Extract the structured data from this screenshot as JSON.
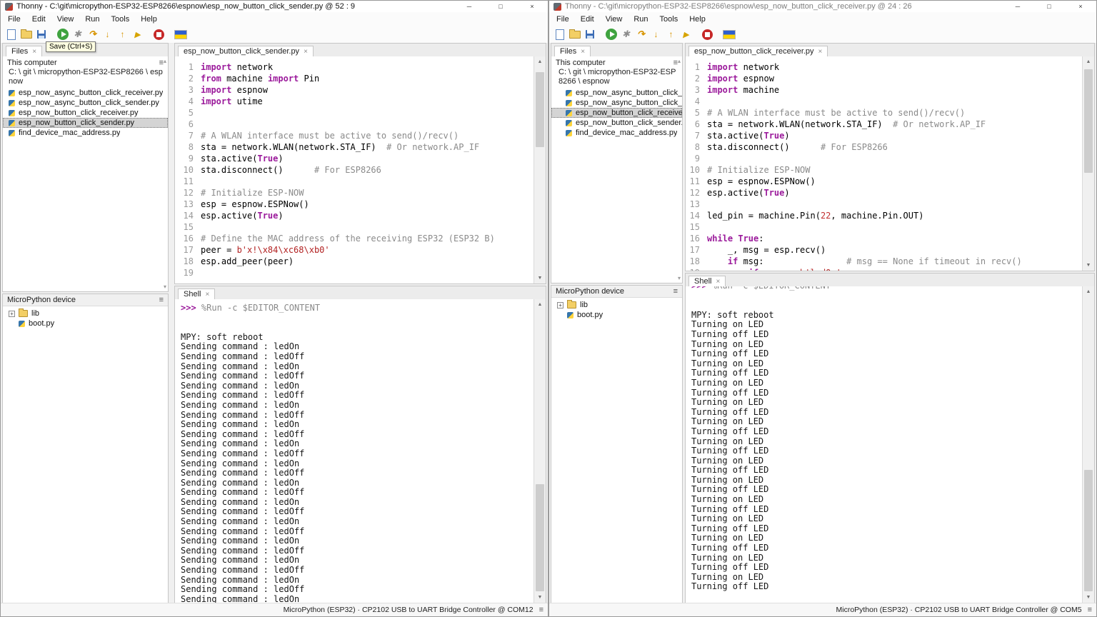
{
  "glyphs": {
    "minimize": "─",
    "maximize": "□",
    "close": "×",
    "pane_menu": "≡",
    "tab_close": "×",
    "expander": "+",
    "scroll_up": "▲",
    "scroll_down": "▼",
    "tree_scroll_up": "▴",
    "tree_scroll_down": "▾",
    "backend_menu": "≡"
  },
  "windows": [
    {
      "titlebar": {
        "title": "Thonny  -  C:\\git\\micropython-ESP32-ESP8266\\espnow\\esp_now_button_click_sender.py  @  52 : 9"
      },
      "menu": [
        "File",
        "Edit",
        "View",
        "Run",
        "Tools",
        "Help"
      ],
      "toolbar": [
        "new-file",
        "open-file",
        "save",
        "sep",
        "run",
        "debug",
        "step-over",
        "step-into",
        "step-out",
        "resume",
        "sep",
        "stop",
        "sep",
        "flag"
      ],
      "tooltip": {
        "text": "Save (Ctrl+S)"
      },
      "files_panel": {
        "tab": "Files",
        "root_label": "This computer",
        "path": "C: \\ git \\ micropython-ESP32-ESP8266 \\ espnow",
        "files": [
          {
            "name": "esp_now_async_button_click_receiver.py",
            "selected": false
          },
          {
            "name": "esp_now_async_button_click_sender.py",
            "selected": false
          },
          {
            "name": "esp_now_button_click_receiver.py",
            "selected": false
          },
          {
            "name": "esp_now_button_click_sender.py",
            "selected": true
          },
          {
            "name": "find_device_mac_address.py",
            "selected": false
          }
        ]
      },
      "device_panel": {
        "title": "MicroPython device",
        "items": [
          {
            "name": "lib",
            "type": "folder",
            "expander": true
          },
          {
            "name": "boot.py",
            "type": "file",
            "expander": false
          }
        ]
      },
      "editor": {
        "tab": "esp_now_button_click_sender.py",
        "lines": [
          {
            "n": 1,
            "segs": [
              [
                "kw",
                "import"
              ],
              [
                "pl",
                " network"
              ]
            ]
          },
          {
            "n": 2,
            "segs": [
              [
                "kw",
                "from"
              ],
              [
                "pl",
                " machine "
              ],
              [
                "kw",
                "import"
              ],
              [
                "pl",
                " Pin"
              ]
            ]
          },
          {
            "n": 3,
            "segs": [
              [
                "kw",
                "import"
              ],
              [
                "pl",
                " espnow"
              ]
            ]
          },
          {
            "n": 4,
            "segs": [
              [
                "kw",
                "import"
              ],
              [
                "pl",
                " utime"
              ]
            ]
          },
          {
            "n": 5,
            "segs": []
          },
          {
            "n": 6,
            "segs": []
          },
          {
            "n": 7,
            "segs": [
              [
                "com",
                "# A WLAN interface must be active to send()/recv()"
              ]
            ]
          },
          {
            "n": 8,
            "segs": [
              [
                "pl",
                "sta = network.WLAN(network.STA_IF)  "
              ],
              [
                "com",
                "# Or network.AP_IF"
              ]
            ]
          },
          {
            "n": 9,
            "segs": [
              [
                "pl",
                "sta.active("
              ],
              [
                "kw",
                "True"
              ],
              [
                "pl",
                ")"
              ]
            ]
          },
          {
            "n": 10,
            "segs": [
              [
                "pl",
                "sta.disconnect()      "
              ],
              [
                "com",
                "# For ESP8266"
              ]
            ]
          },
          {
            "n": 11,
            "segs": []
          },
          {
            "n": 12,
            "segs": [
              [
                "com",
                "# Initialize ESP-NOW"
              ]
            ]
          },
          {
            "n": 13,
            "segs": [
              [
                "pl",
                "esp = espnow.ESPNow()"
              ]
            ]
          },
          {
            "n": 14,
            "segs": [
              [
                "pl",
                "esp.active("
              ],
              [
                "kw",
                "True"
              ],
              [
                "pl",
                ")"
              ]
            ]
          },
          {
            "n": 15,
            "segs": []
          },
          {
            "n": 16,
            "segs": [
              [
                "com",
                "# Define the MAC address of the receiving ESP32 (ESP32 B)"
              ]
            ]
          },
          {
            "n": 17,
            "segs": [
              [
                "pl",
                "peer = "
              ],
              [
                "str",
                "b'x!\\x84\\xc68\\xb0'"
              ]
            ]
          },
          {
            "n": 18,
            "segs": [
              [
                "pl",
                "esp.add_peer(peer)"
              ]
            ]
          },
          {
            "n": 19,
            "segs": []
          }
        ]
      },
      "shell": {
        "tab": "Shell",
        "lines": [
          [
            [
              "prompt",
              ">>> "
            ],
            [
              "magic",
              "%Run -c $EDITOR_CONTENT"
            ]
          ],
          [],
          [],
          [
            [
              "out",
              "MPY: soft reboot"
            ]
          ],
          [
            [
              "out",
              "Sending command : ledOn"
            ]
          ],
          [
            [
              "out",
              "Sending command : ledOff"
            ]
          ],
          [
            [
              "out",
              "Sending command : ledOn"
            ]
          ],
          [
            [
              "out",
              "Sending command : ledOff"
            ]
          ],
          [
            [
              "out",
              "Sending command : ledOn"
            ]
          ],
          [
            [
              "out",
              "Sending command : ledOff"
            ]
          ],
          [
            [
              "out",
              "Sending command : ledOn"
            ]
          ],
          [
            [
              "out",
              "Sending command : ledOff"
            ]
          ],
          [
            [
              "out",
              "Sending command : ledOn"
            ]
          ],
          [
            [
              "out",
              "Sending command : ledOff"
            ]
          ],
          [
            [
              "out",
              "Sending command : ledOn"
            ]
          ],
          [
            [
              "out",
              "Sending command : ledOff"
            ]
          ],
          [
            [
              "out",
              "Sending command : ledOn"
            ]
          ],
          [
            [
              "out",
              "Sending command : ledOff"
            ]
          ],
          [
            [
              "out",
              "Sending command : ledOn"
            ]
          ],
          [
            [
              "out",
              "Sending command : ledOff"
            ]
          ],
          [
            [
              "out",
              "Sending command : ledOn"
            ]
          ],
          [
            [
              "out",
              "Sending command : ledOff"
            ]
          ],
          [
            [
              "out",
              "Sending command : ledOn"
            ]
          ],
          [
            [
              "out",
              "Sending command : ledOff"
            ]
          ],
          [
            [
              "out",
              "Sending command : ledOn"
            ]
          ],
          [
            [
              "out",
              "Sending command : ledOff"
            ]
          ],
          [
            [
              "out",
              "Sending command : ledOn"
            ]
          ],
          [
            [
              "out",
              "Sending command : ledOff"
            ]
          ],
          [
            [
              "out",
              "Sending command : ledOn"
            ]
          ],
          [
            [
              "out",
              "Sending command : ledOff"
            ]
          ],
          [
            [
              "out",
              "Sending command : ledOn"
            ]
          ]
        ]
      },
      "statusbar": {
        "text": "MicroPython (ESP32)  ·  CP2102 USB to UART Bridge Controller @ COM12"
      }
    },
    {
      "titlebar": {
        "title": "Thonny  -  C:\\git\\micropython-ESP32-ESP8266\\espnow\\esp_now_button_click_receiver.py  @  24 : 26"
      },
      "menu": [
        "File",
        "Edit",
        "View",
        "Run",
        "Tools",
        "Help"
      ],
      "toolbar": [
        "new-file",
        "open-file",
        "save",
        "sep",
        "run",
        "debug",
        "step-over",
        "step-into",
        "step-out",
        "resume",
        "sep",
        "stop",
        "sep",
        "flag"
      ],
      "files_panel": {
        "tab": "Files",
        "root_label": "This computer",
        "path": "C: \\ git \\ micropython-ESP32-ESP8266 \\ espnow",
        "files": [
          {
            "name": "esp_now_async_button_click_receiver.py",
            "selected": false
          },
          {
            "name": "esp_now_async_button_click_sender.py",
            "selected": false
          },
          {
            "name": "esp_now_button_click_receiver.py",
            "selected": true
          },
          {
            "name": "esp_now_button_click_sender.py",
            "selected": false
          },
          {
            "name": "find_device_mac_address.py",
            "selected": false
          }
        ]
      },
      "device_panel": {
        "title": "MicroPython device",
        "items": [
          {
            "name": "lib",
            "type": "folder",
            "expander": true
          },
          {
            "name": "boot.py",
            "type": "file",
            "expander": false
          }
        ]
      },
      "editor": {
        "tab": "esp_now_button_click_receiver.py",
        "lines": [
          {
            "n": 1,
            "segs": [
              [
                "kw",
                "import"
              ],
              [
                "pl",
                " network"
              ]
            ]
          },
          {
            "n": 2,
            "segs": [
              [
                "kw",
                "import"
              ],
              [
                "pl",
                " espnow"
              ]
            ]
          },
          {
            "n": 3,
            "segs": [
              [
                "kw",
                "import"
              ],
              [
                "pl",
                " machine"
              ]
            ]
          },
          {
            "n": 4,
            "segs": []
          },
          {
            "n": 5,
            "segs": [
              [
                "com",
                "# A WLAN interface must be active to send()/recv()"
              ]
            ]
          },
          {
            "n": 6,
            "segs": [
              [
                "pl",
                "sta = network.WLAN(network.STA_IF)  "
              ],
              [
                "com",
                "# Or network.AP_IF"
              ]
            ]
          },
          {
            "n": 7,
            "segs": [
              [
                "pl",
                "sta.active("
              ],
              [
                "kw",
                "True"
              ],
              [
                "pl",
                ")"
              ]
            ]
          },
          {
            "n": 8,
            "segs": [
              [
                "pl",
                "sta.disconnect()      "
              ],
              [
                "com",
                "# For ESP8266"
              ]
            ]
          },
          {
            "n": 9,
            "segs": []
          },
          {
            "n": 10,
            "segs": [
              [
                "com",
                "# Initialize ESP-NOW"
              ]
            ]
          },
          {
            "n": 11,
            "segs": [
              [
                "pl",
                "esp = espnow.ESPNow()"
              ]
            ]
          },
          {
            "n": 12,
            "segs": [
              [
                "pl",
                "esp.active("
              ],
              [
                "kw",
                "True"
              ],
              [
                "pl",
                ")"
              ]
            ]
          },
          {
            "n": 13,
            "segs": []
          },
          {
            "n": 14,
            "segs": [
              [
                "pl",
                "led_pin = machine.Pin("
              ],
              [
                "num",
                "22"
              ],
              [
                "pl",
                ", machine.Pin.OUT)"
              ]
            ]
          },
          {
            "n": 15,
            "segs": []
          },
          {
            "n": 16,
            "segs": [
              [
                "kw",
                "while"
              ],
              [
                "pl",
                " "
              ],
              [
                "kw",
                "True"
              ],
              [
                "pl",
                ":"
              ]
            ]
          },
          {
            "n": 17,
            "segs": [
              [
                "pl",
                "    _, msg = esp.recv()"
              ]
            ]
          },
          {
            "n": 18,
            "segs": [
              [
                "pl",
                "    "
              ],
              [
                "kw",
                "if"
              ],
              [
                "pl",
                " msg:                "
              ],
              [
                "com",
                "# msg == None if timeout in recv()"
              ]
            ]
          },
          {
            "n": 19,
            "segs": [
              [
                "pl",
                "        "
              ],
              [
                "kw",
                "if"
              ],
              [
                "pl",
                " msg == "
              ],
              [
                "str",
                "b'ledOn'"
              ],
              [
                "pl",
                ":"
              ]
            ]
          }
        ]
      },
      "shell": {
        "tab": "Shell",
        "lines": [
          [
            [
              "prompt",
              ">>> "
            ],
            [
              "magic",
              "%Run -c $EDITOR_CONTENT"
            ]
          ],
          [],
          [],
          [
            [
              "out",
              "MPY: soft reboot"
            ]
          ],
          [
            [
              "out",
              "Turning on LED"
            ]
          ],
          [
            [
              "out",
              "Turning off LED"
            ]
          ],
          [
            [
              "out",
              "Turning on LED"
            ]
          ],
          [
            [
              "out",
              "Turning off LED"
            ]
          ],
          [
            [
              "out",
              "Turning on LED"
            ]
          ],
          [
            [
              "out",
              "Turning off LED"
            ]
          ],
          [
            [
              "out",
              "Turning on LED"
            ]
          ],
          [
            [
              "out",
              "Turning off LED"
            ]
          ],
          [
            [
              "out",
              "Turning on LED"
            ]
          ],
          [
            [
              "out",
              "Turning off LED"
            ]
          ],
          [
            [
              "out",
              "Turning on LED"
            ]
          ],
          [
            [
              "out",
              "Turning off LED"
            ]
          ],
          [
            [
              "out",
              "Turning on LED"
            ]
          ],
          [
            [
              "out",
              "Turning off LED"
            ]
          ],
          [
            [
              "out",
              "Turning on LED"
            ]
          ],
          [
            [
              "out",
              "Turning off LED"
            ]
          ],
          [
            [
              "out",
              "Turning on LED"
            ]
          ],
          [
            [
              "out",
              "Turning off LED"
            ]
          ],
          [
            [
              "out",
              "Turning on LED"
            ]
          ],
          [
            [
              "out",
              "Turning off LED"
            ]
          ],
          [
            [
              "out",
              "Turning on LED"
            ]
          ],
          [
            [
              "out",
              "Turning off LED"
            ]
          ],
          [
            [
              "out",
              "Turning on LED"
            ]
          ],
          [
            [
              "out",
              "Turning off LED"
            ]
          ],
          [
            [
              "out",
              "Turning on LED"
            ]
          ],
          [
            [
              "out",
              "Turning off LED"
            ]
          ],
          [
            [
              "out",
              "Turning on LED"
            ]
          ],
          [
            [
              "out",
              "Turning off LED"
            ]
          ]
        ]
      },
      "statusbar": {
        "text": "MicroPython (ESP32)  ·  CP2102 USB to UART Bridge Controller @ COM5"
      }
    }
  ]
}
